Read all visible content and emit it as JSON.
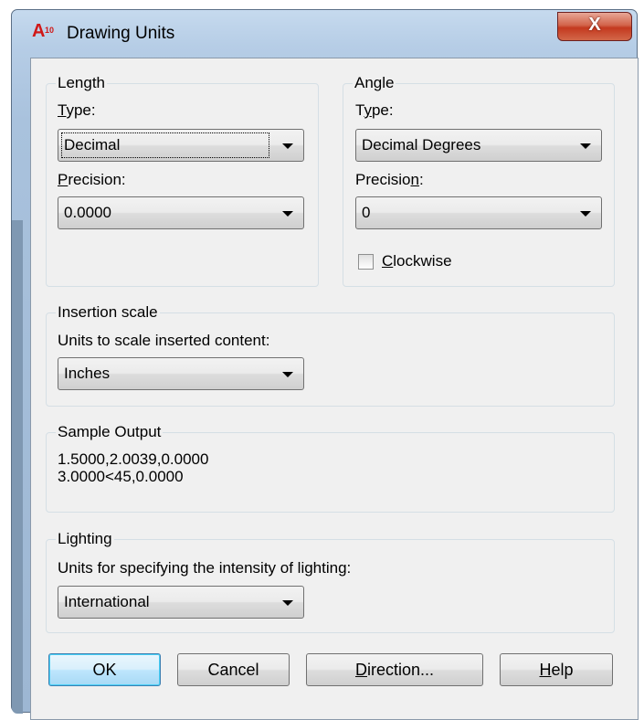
{
  "window": {
    "title": "Drawing Units",
    "app_icon": "autocad-a10-icon",
    "close_label": "X"
  },
  "length": {
    "legend": "Length",
    "type_label": "Type:",
    "type_value": "Decimal",
    "precision_label": "Precision:",
    "precision_value": "0.0000"
  },
  "angle": {
    "legend": "Angle",
    "type_label": "Type:",
    "type_value": "Decimal Degrees",
    "precision_label": "Precision:",
    "precision_value": "0",
    "clockwise_label": "Clockwise",
    "clockwise_checked": false
  },
  "insertion": {
    "legend": "Insertion scale",
    "label": "Units to scale inserted content:",
    "value": "Inches"
  },
  "sample": {
    "legend": "Sample Output",
    "line1": "1.5000,2.0039,0.0000",
    "line2": "3.0000<45,0.0000"
  },
  "lighting": {
    "legend": "Lighting",
    "label": "Units for specifying the intensity of lighting:",
    "value": "International"
  },
  "buttons": {
    "ok": "OK",
    "cancel": "Cancel",
    "direction": "Direction...",
    "help": "Help"
  }
}
